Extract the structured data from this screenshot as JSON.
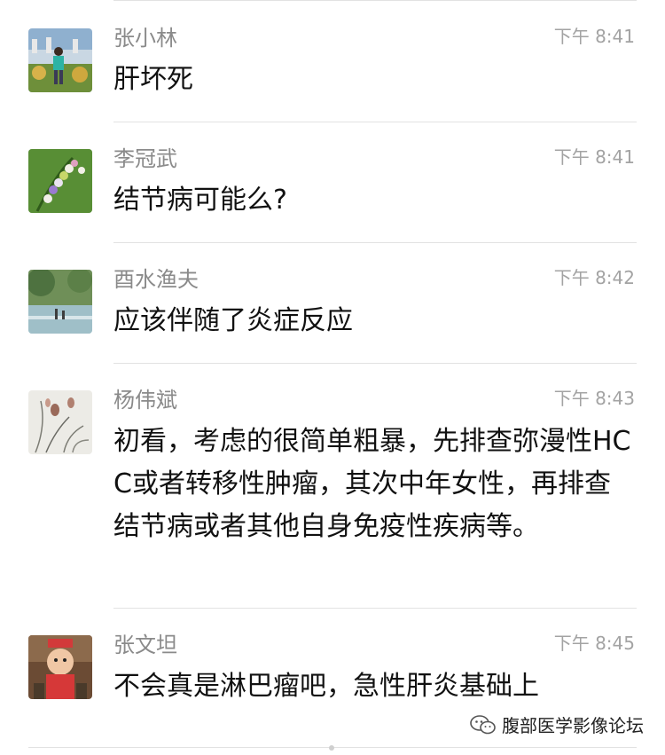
{
  "messages": [
    {
      "name": "张小林",
      "time": "下午 8:41",
      "text": "肝坏死",
      "avatar": "avatar-person-outdoors"
    },
    {
      "name": "李冠武",
      "time": "下午 8:41",
      "text": "结节病可能么?",
      "avatar": "avatar-flowers"
    },
    {
      "name": "酉水渔夫",
      "time": "下午 8:42",
      "text": "应该伴随了炎症反应",
      "avatar": "avatar-landscape"
    },
    {
      "name": "杨伟斌",
      "time": "下午 8:43",
      "text": "初看，考虑的很简单粗暴，先排查弥漫性HCC或者转移性肿瘤，其次中年女性，再排查结节病或者其他自身免疫性疾病等。",
      "avatar": "avatar-orchid-painting"
    },
    {
      "name": "张文坦",
      "time": "下午 8:45",
      "text": "不会真是淋巴瘤吧，急性肝炎基础上",
      "avatar": "avatar-child"
    }
  ],
  "watermark": {
    "label": "腹部医学影像论坛",
    "icon": "wechat-icon"
  }
}
